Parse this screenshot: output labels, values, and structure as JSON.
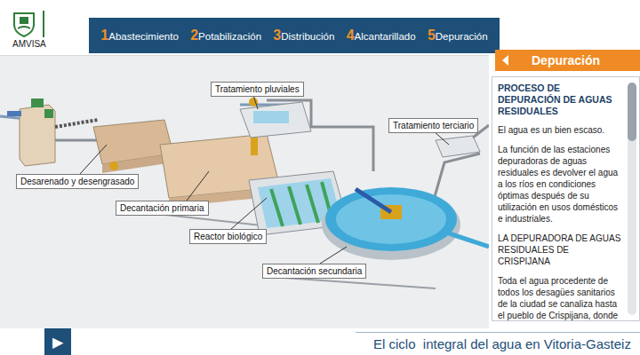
{
  "logo": {
    "text": "AMVISA"
  },
  "nav": [
    {
      "number": "1",
      "label": "Abastecimiento",
      "selected": false
    },
    {
      "number": "2",
      "label": "Potabilización",
      "selected": false
    },
    {
      "number": "3",
      "label": "Distribución",
      "selected": false
    },
    {
      "number": "4",
      "label": "Alcantarillado",
      "selected": false
    },
    {
      "number": "5",
      "label": "Depuración",
      "selected": false
    }
  ],
  "diagram": {
    "labels": [
      "Tratamiento pluviales",
      "Tratamiento terciario",
      "Desarenado y desengrasado",
      "Decantación primaria",
      "Reactor biológico",
      "Decantación secundaria"
    ]
  },
  "panel": {
    "tab": "Depuración",
    "heading": "PROCESO DE DEPURACIÓN DE AGUAS RESIDUALES",
    "paragraphs": [
      "El agua es un bien escaso.",
      "La función de las estaciones depuradoras de aguas residuales es devolver el agua a los ríos en condiciones óptimas después de su utilización en usos domésticos e industriales.",
      "LA DEPURADORA DE AGUAS RESIDUALES DE CRISPIJANA",
      "Toda el agua procedente de todos los desagües sanitarios de la ciudad se canaliza hasta el pueblo de Crispijana, donde"
    ],
    "scrollbar": {
      "level": 0.25
    }
  },
  "footer": {
    "play": "▶",
    "title": "El ciclo  integral del agua en Vitoria-Gasteiz"
  }
}
